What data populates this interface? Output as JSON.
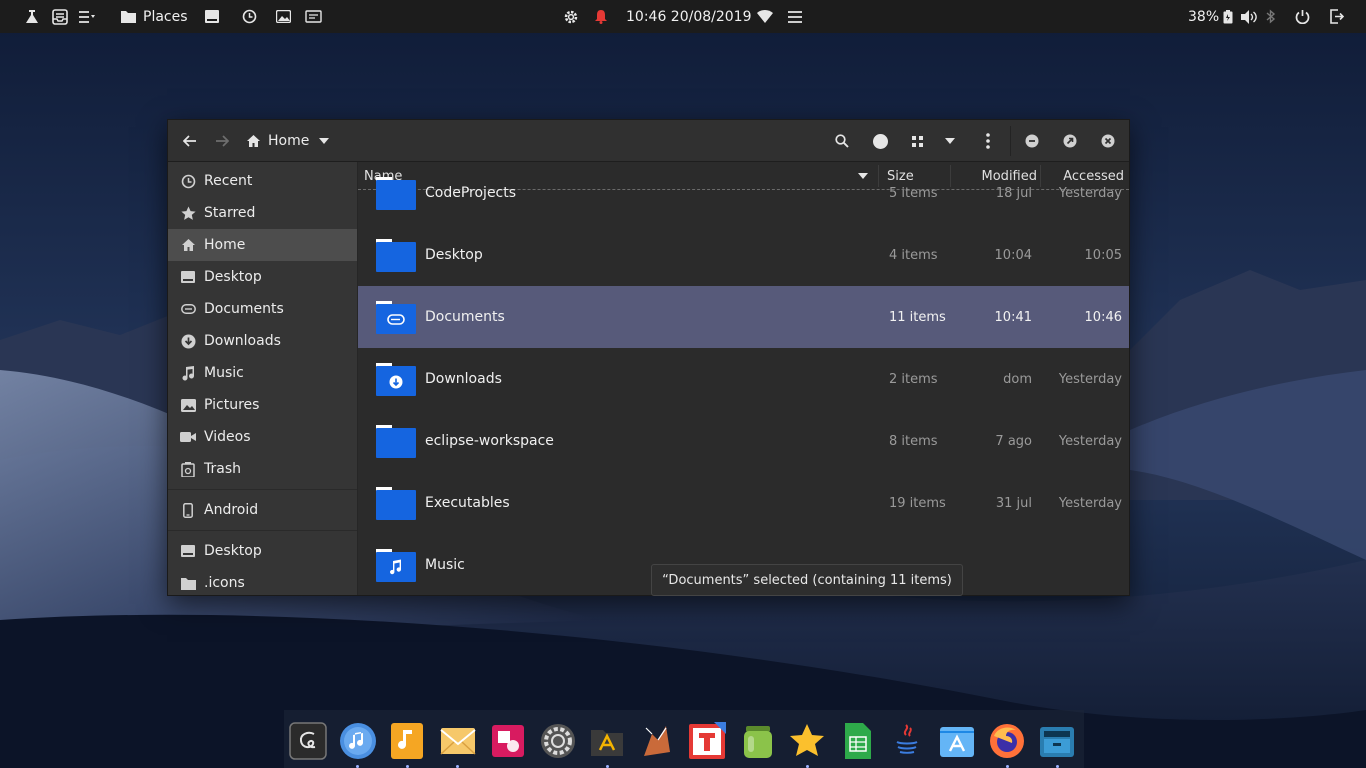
{
  "topbar": {
    "places_label": "Places",
    "clock": "10:46 20/08/2019",
    "battery": "38%"
  },
  "window": {
    "location_label": "Home"
  },
  "sidebar": {
    "items": [
      {
        "label": "Recent",
        "icon": "clock-icon"
      },
      {
        "label": "Starred",
        "icon": "star-icon"
      },
      {
        "label": "Home",
        "icon": "home-icon",
        "active": true
      },
      {
        "label": "Desktop",
        "icon": "desktop-icon"
      },
      {
        "label": "Documents",
        "icon": "document-icon"
      },
      {
        "label": "Downloads",
        "icon": "download-icon"
      },
      {
        "label": "Music",
        "icon": "music-icon"
      },
      {
        "label": "Pictures",
        "icon": "picture-icon"
      },
      {
        "label": "Videos",
        "icon": "video-icon"
      },
      {
        "label": "Trash",
        "icon": "trash-icon"
      }
    ],
    "devices": [
      {
        "label": "Android",
        "icon": "phone-icon"
      }
    ],
    "bookmarks": [
      {
        "label": "Desktop",
        "icon": "desktop-icon"
      },
      {
        "label": ".icons",
        "icon": "folder-icon"
      }
    ]
  },
  "columns": {
    "name": "Name",
    "size": "Size",
    "modified": "Modified",
    "accessed": "Accessed"
  },
  "files": [
    {
      "name": "CodeProjects",
      "size": "5 items",
      "modified": "18 jul",
      "accessed": "Yesterday",
      "emblem": ""
    },
    {
      "name": "Desktop",
      "size": "4 items",
      "modified": "10:04",
      "accessed": "10:05",
      "emblem": ""
    },
    {
      "name": "Documents",
      "size": "11 items",
      "modified": "10:41",
      "accessed": "10:46",
      "emblem": "paperclip",
      "selected": true
    },
    {
      "name": "Downloads",
      "size": "2 items",
      "modified": "dom",
      "accessed": "Yesterday",
      "emblem": "download"
    },
    {
      "name": "eclipse-workspace",
      "size": "8 items",
      "modified": "7 ago",
      "accessed": "Yesterday",
      "emblem": ""
    },
    {
      "name": "Executables",
      "size": "19 items",
      "modified": "31 jul",
      "accessed": "Yesterday",
      "emblem": ""
    },
    {
      "name": "Music",
      "size": "",
      "modified": "",
      "accessed": "",
      "emblem": "music"
    }
  ],
  "status": "“Documents” selected  (containing 11 items)",
  "colors": {
    "folder": "#1565e0",
    "selection": "#575a7a",
    "notification": "#e53935"
  }
}
